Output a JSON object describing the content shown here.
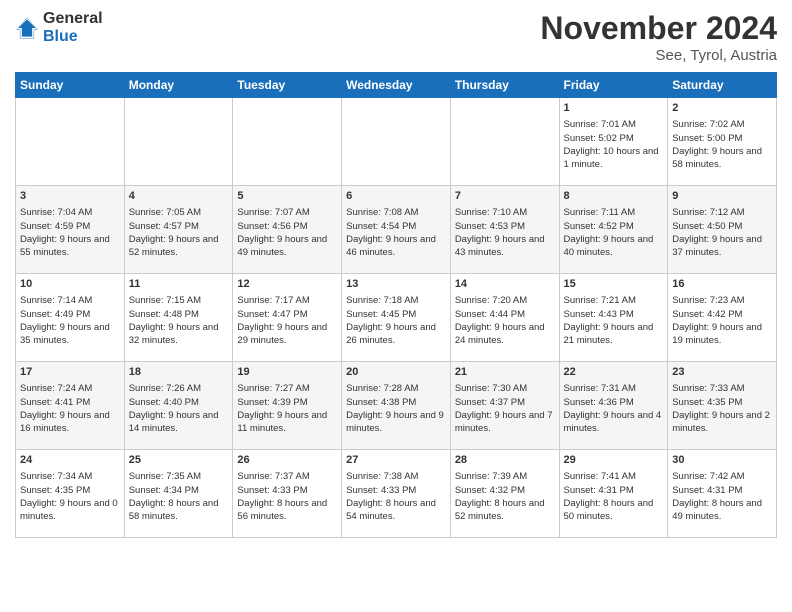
{
  "logo": {
    "general": "General",
    "blue": "Blue"
  },
  "header": {
    "title": "November 2024",
    "subtitle": "See, Tyrol, Austria"
  },
  "weekdays": [
    "Sunday",
    "Monday",
    "Tuesday",
    "Wednesday",
    "Thursday",
    "Friday",
    "Saturday"
  ],
  "weeks": [
    [
      {
        "day": "",
        "sunrise": "",
        "sunset": "",
        "daylight": ""
      },
      {
        "day": "",
        "sunrise": "",
        "sunset": "",
        "daylight": ""
      },
      {
        "day": "",
        "sunrise": "",
        "sunset": "",
        "daylight": ""
      },
      {
        "day": "",
        "sunrise": "",
        "sunset": "",
        "daylight": ""
      },
      {
        "day": "",
        "sunrise": "",
        "sunset": "",
        "daylight": ""
      },
      {
        "day": "1",
        "sunrise": "Sunrise: 7:01 AM",
        "sunset": "Sunset: 5:02 PM",
        "daylight": "Daylight: 10 hours and 1 minute."
      },
      {
        "day": "2",
        "sunrise": "Sunrise: 7:02 AM",
        "sunset": "Sunset: 5:00 PM",
        "daylight": "Daylight: 9 hours and 58 minutes."
      }
    ],
    [
      {
        "day": "3",
        "sunrise": "Sunrise: 7:04 AM",
        "sunset": "Sunset: 4:59 PM",
        "daylight": "Daylight: 9 hours and 55 minutes."
      },
      {
        "day": "4",
        "sunrise": "Sunrise: 7:05 AM",
        "sunset": "Sunset: 4:57 PM",
        "daylight": "Daylight: 9 hours and 52 minutes."
      },
      {
        "day": "5",
        "sunrise": "Sunrise: 7:07 AM",
        "sunset": "Sunset: 4:56 PM",
        "daylight": "Daylight: 9 hours and 49 minutes."
      },
      {
        "day": "6",
        "sunrise": "Sunrise: 7:08 AM",
        "sunset": "Sunset: 4:54 PM",
        "daylight": "Daylight: 9 hours and 46 minutes."
      },
      {
        "day": "7",
        "sunrise": "Sunrise: 7:10 AM",
        "sunset": "Sunset: 4:53 PM",
        "daylight": "Daylight: 9 hours and 43 minutes."
      },
      {
        "day": "8",
        "sunrise": "Sunrise: 7:11 AM",
        "sunset": "Sunset: 4:52 PM",
        "daylight": "Daylight: 9 hours and 40 minutes."
      },
      {
        "day": "9",
        "sunrise": "Sunrise: 7:12 AM",
        "sunset": "Sunset: 4:50 PM",
        "daylight": "Daylight: 9 hours and 37 minutes."
      }
    ],
    [
      {
        "day": "10",
        "sunrise": "Sunrise: 7:14 AM",
        "sunset": "Sunset: 4:49 PM",
        "daylight": "Daylight: 9 hours and 35 minutes."
      },
      {
        "day": "11",
        "sunrise": "Sunrise: 7:15 AM",
        "sunset": "Sunset: 4:48 PM",
        "daylight": "Daylight: 9 hours and 32 minutes."
      },
      {
        "day": "12",
        "sunrise": "Sunrise: 7:17 AM",
        "sunset": "Sunset: 4:47 PM",
        "daylight": "Daylight: 9 hours and 29 minutes."
      },
      {
        "day": "13",
        "sunrise": "Sunrise: 7:18 AM",
        "sunset": "Sunset: 4:45 PM",
        "daylight": "Daylight: 9 hours and 26 minutes."
      },
      {
        "day": "14",
        "sunrise": "Sunrise: 7:20 AM",
        "sunset": "Sunset: 4:44 PM",
        "daylight": "Daylight: 9 hours and 24 minutes."
      },
      {
        "day": "15",
        "sunrise": "Sunrise: 7:21 AM",
        "sunset": "Sunset: 4:43 PM",
        "daylight": "Daylight: 9 hours and 21 minutes."
      },
      {
        "day": "16",
        "sunrise": "Sunrise: 7:23 AM",
        "sunset": "Sunset: 4:42 PM",
        "daylight": "Daylight: 9 hours and 19 minutes."
      }
    ],
    [
      {
        "day": "17",
        "sunrise": "Sunrise: 7:24 AM",
        "sunset": "Sunset: 4:41 PM",
        "daylight": "Daylight: 9 hours and 16 minutes."
      },
      {
        "day": "18",
        "sunrise": "Sunrise: 7:26 AM",
        "sunset": "Sunset: 4:40 PM",
        "daylight": "Daylight: 9 hours and 14 minutes."
      },
      {
        "day": "19",
        "sunrise": "Sunrise: 7:27 AM",
        "sunset": "Sunset: 4:39 PM",
        "daylight": "Daylight: 9 hours and 11 minutes."
      },
      {
        "day": "20",
        "sunrise": "Sunrise: 7:28 AM",
        "sunset": "Sunset: 4:38 PM",
        "daylight": "Daylight: 9 hours and 9 minutes."
      },
      {
        "day": "21",
        "sunrise": "Sunrise: 7:30 AM",
        "sunset": "Sunset: 4:37 PM",
        "daylight": "Daylight: 9 hours and 7 minutes."
      },
      {
        "day": "22",
        "sunrise": "Sunrise: 7:31 AM",
        "sunset": "Sunset: 4:36 PM",
        "daylight": "Daylight: 9 hours and 4 minutes."
      },
      {
        "day": "23",
        "sunrise": "Sunrise: 7:33 AM",
        "sunset": "Sunset: 4:35 PM",
        "daylight": "Daylight: 9 hours and 2 minutes."
      }
    ],
    [
      {
        "day": "24",
        "sunrise": "Sunrise: 7:34 AM",
        "sunset": "Sunset: 4:35 PM",
        "daylight": "Daylight: 9 hours and 0 minutes."
      },
      {
        "day": "25",
        "sunrise": "Sunrise: 7:35 AM",
        "sunset": "Sunset: 4:34 PM",
        "daylight": "Daylight: 8 hours and 58 minutes."
      },
      {
        "day": "26",
        "sunrise": "Sunrise: 7:37 AM",
        "sunset": "Sunset: 4:33 PM",
        "daylight": "Daylight: 8 hours and 56 minutes."
      },
      {
        "day": "27",
        "sunrise": "Sunrise: 7:38 AM",
        "sunset": "Sunset: 4:33 PM",
        "daylight": "Daylight: 8 hours and 54 minutes."
      },
      {
        "day": "28",
        "sunrise": "Sunrise: 7:39 AM",
        "sunset": "Sunset: 4:32 PM",
        "daylight": "Daylight: 8 hours and 52 minutes."
      },
      {
        "day": "29",
        "sunrise": "Sunrise: 7:41 AM",
        "sunset": "Sunset: 4:31 PM",
        "daylight": "Daylight: 8 hours and 50 minutes."
      },
      {
        "day": "30",
        "sunrise": "Sunrise: 7:42 AM",
        "sunset": "Sunset: 4:31 PM",
        "daylight": "Daylight: 8 hours and 49 minutes."
      }
    ]
  ]
}
